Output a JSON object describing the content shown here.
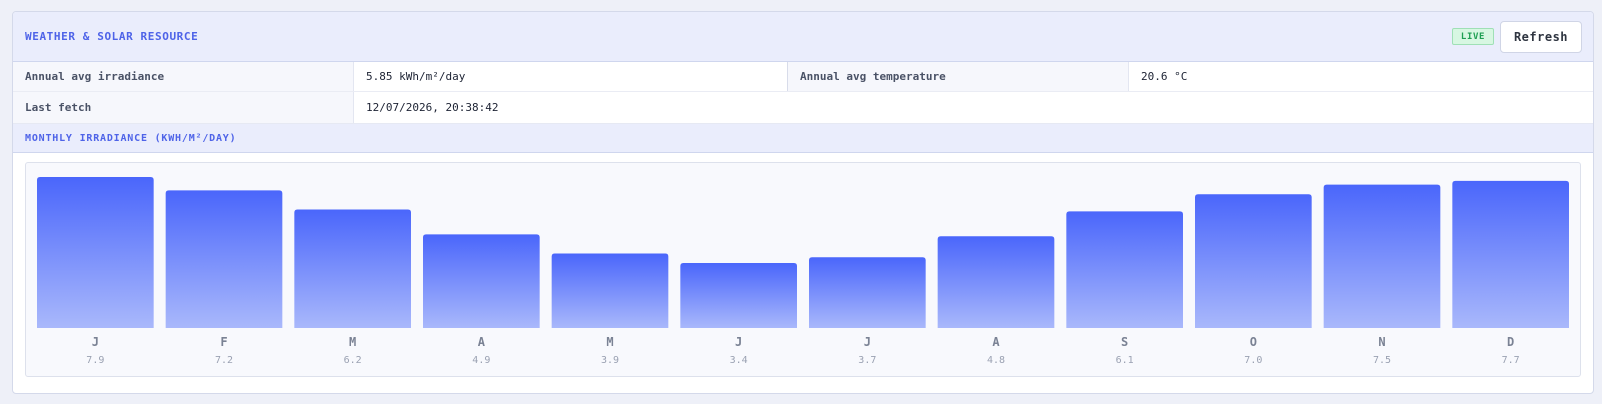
{
  "panel": {
    "title": "WEATHER & SOLAR RESOURCE",
    "badge": "LIVE",
    "refresh_label": "Refresh"
  },
  "info": {
    "irradiance_label": "Annual avg irradiance",
    "irradiance_value": "5.85 kWh/m²/day",
    "temperature_label": "Annual avg temperature",
    "temperature_value": "20.6 °C",
    "last_fetch_label": "Last fetch",
    "last_fetch_value": "12/07/2026, 20:38:42"
  },
  "section": {
    "title": "MONTHLY IRRADIANCE (KWH/M²/DAY)"
  },
  "colors": {
    "accent": "#4e63e8",
    "bar_top": "#4a66fb",
    "bar_bottom": "#a9b8fb",
    "live_green": "#1f9f53"
  },
  "chart_data": {
    "type": "bar",
    "categories": [
      "J",
      "F",
      "M",
      "A",
      "M",
      "J",
      "J",
      "A",
      "S",
      "O",
      "N",
      "D"
    ],
    "values": [
      7.9,
      7.2,
      6.2,
      4.9,
      3.9,
      3.4,
      3.7,
      4.8,
      6.1,
      7.0,
      7.5,
      7.7
    ],
    "value_labels": [
      "7.9",
      "7.2",
      "6.2",
      "4.9",
      "3.9",
      "3.4",
      "3.7",
      "4.8",
      "6.1",
      "7.0",
      "7.5",
      "7.7"
    ],
    "title": "",
    "xlabel": "",
    "ylabel": "",
    "grid": false,
    "legend": "none"
  }
}
